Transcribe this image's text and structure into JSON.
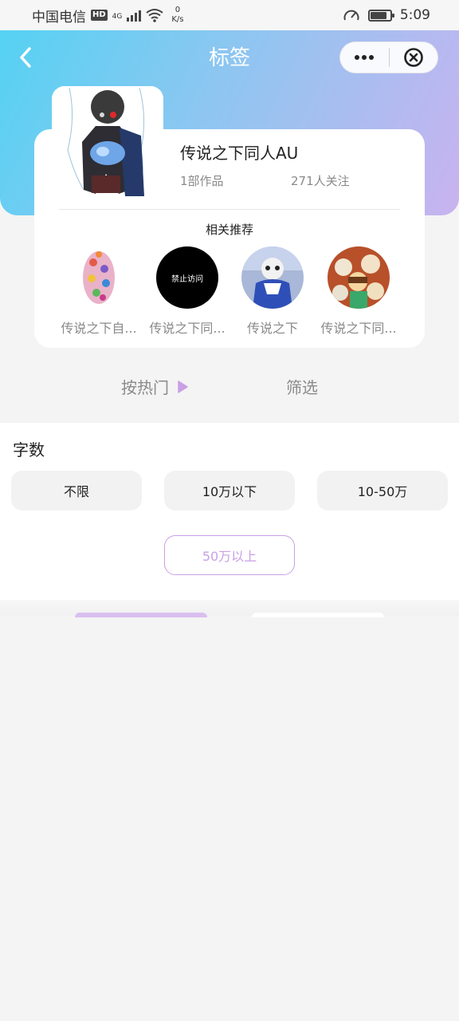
{
  "status_bar": {
    "carrier": "中国电信",
    "hd": "HD",
    "network": "4G",
    "speed_value": "0",
    "speed_unit": "K/s",
    "time": "5:09",
    "battery_level": 0.85
  },
  "header": {
    "title": "标签",
    "back_icon": "chevron-left-icon",
    "more_icon": "more-dots-icon",
    "close_icon": "circle-close-icon"
  },
  "tag": {
    "name": "传说之下同人AU",
    "works": "1部作品",
    "followers": "271人关注"
  },
  "related": {
    "title": "相关推荐",
    "items": [
      {
        "label": "传说之下自...",
        "thumb_text": ""
      },
      {
        "label": "传说之下同...",
        "thumb_text": "禁止访问"
      },
      {
        "label": "传说之下",
        "thumb_text": ""
      },
      {
        "label": "传说之下同...",
        "thumb_text": ""
      }
    ]
  },
  "sort": {
    "hot": "按热门",
    "filter": "筛选"
  },
  "filter_panel": {
    "heading": "字数",
    "options": [
      "不限",
      "10万以下",
      "10-50万",
      "50万以上"
    ],
    "selected_index": 3
  },
  "colors": {
    "accent_purple": "#c9a0e6",
    "gradient_start": "#55d2f2",
    "gradient_end": "#c9b3ef"
  }
}
